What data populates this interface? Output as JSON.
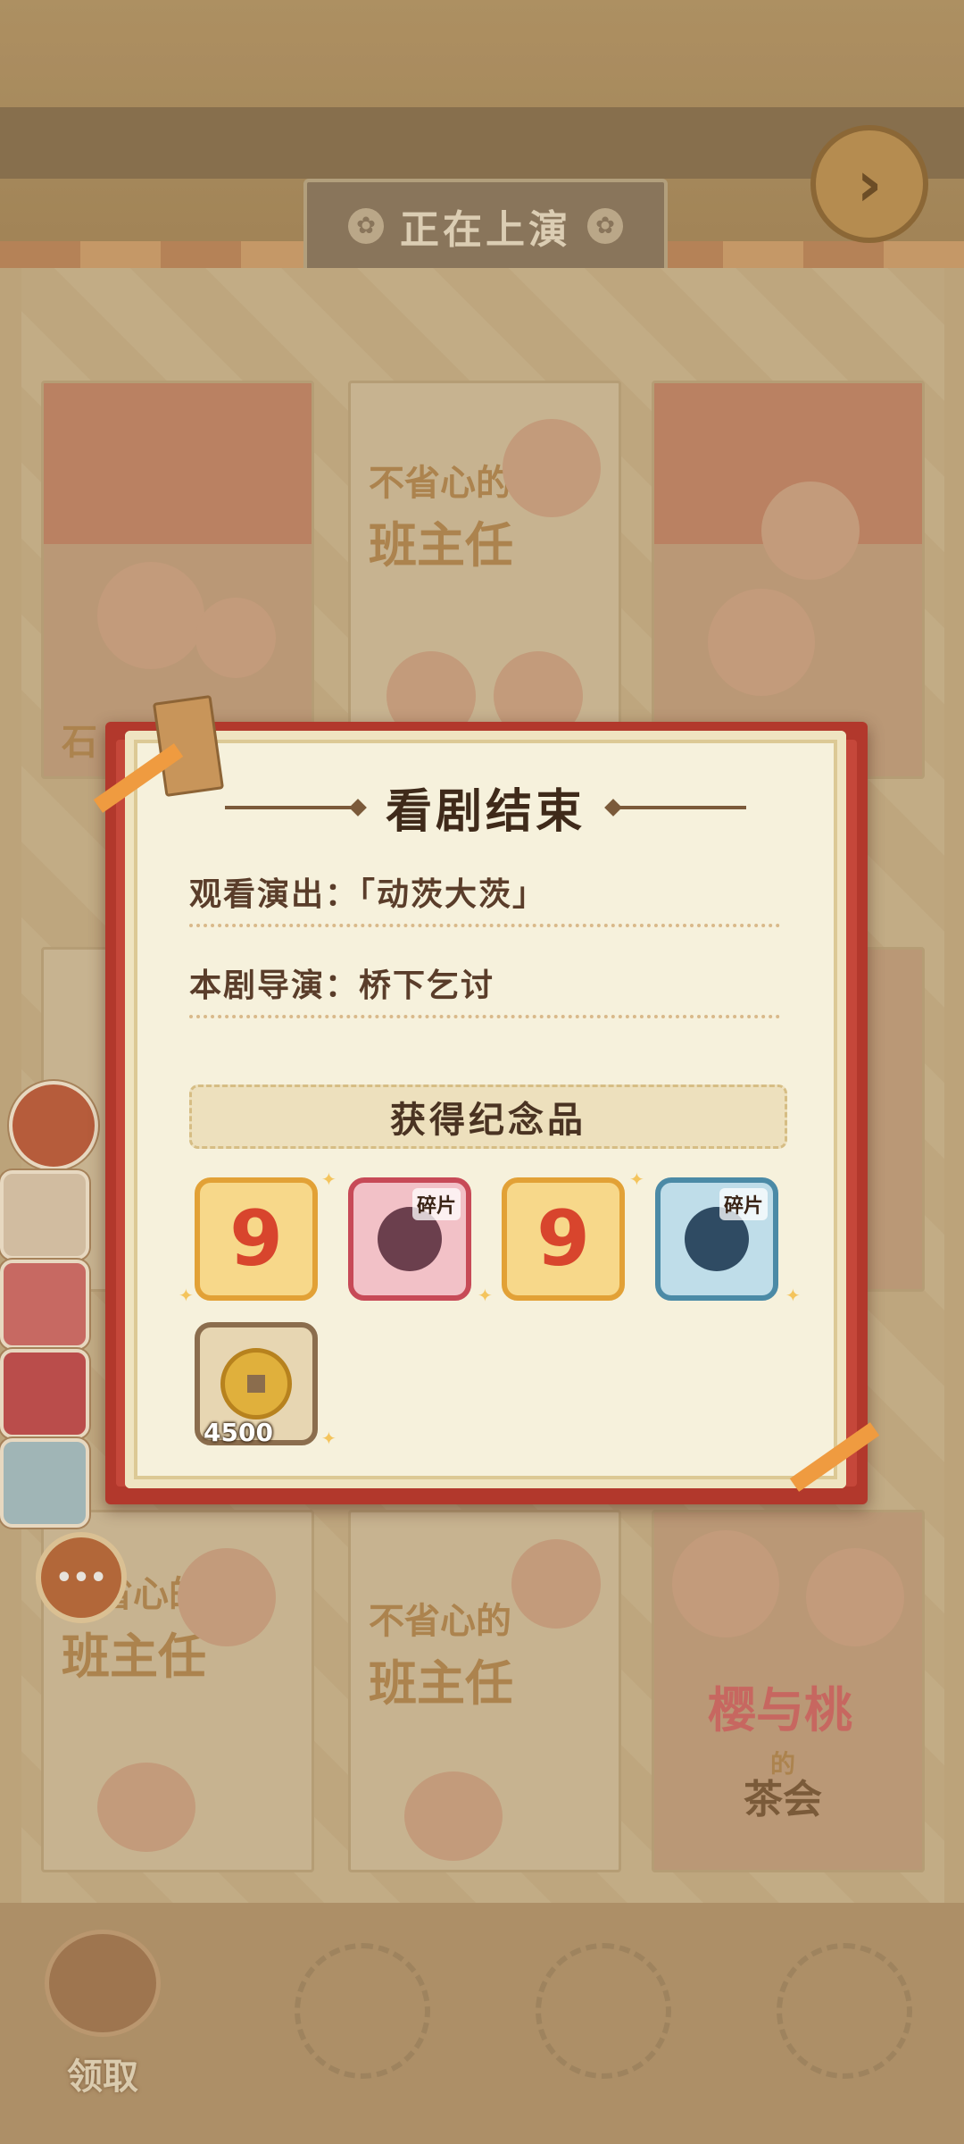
{
  "header": {
    "now_playing_label": "正在上演",
    "next_icon": "chevron-right-icon"
  },
  "posters": {
    "top_left_caption": "石",
    "top_middle_title_1": "不省心的",
    "top_middle_title_2": "班主任",
    "bottom_left_title_1": "不省心的",
    "bottom_left_title_2": "班主任",
    "bottom_middle_title_1": "不省心的",
    "bottom_middle_title_2": "班主任",
    "bottom_right_title": "樱与桃",
    "bottom_right_sub": "的",
    "bottom_right_sub2": "茶会"
  },
  "sidebar": {
    "more_icon": "more-icon"
  },
  "dialog": {
    "title": "看剧结束",
    "show_row": "观看演出：「动茨大茨」",
    "director_row": "本剧导演：桥下乞讨",
    "souvenir_label": "获得纪念品",
    "rewards": [
      {
        "kind": "ticket",
        "glyph": "9",
        "chip": ""
      },
      {
        "kind": "character-fragment",
        "glyph": "",
        "chip": "碎片"
      },
      {
        "kind": "ticket",
        "glyph": "9",
        "chip": ""
      },
      {
        "kind": "character-fragment",
        "glyph": "",
        "chip": "碎片"
      },
      {
        "kind": "coin",
        "glyph": "",
        "chip": "",
        "qty": "4500"
      }
    ]
  },
  "dock": {
    "claim_label": "领取"
  },
  "colors": {
    "dialog_frame": "#b2382c",
    "paper": "#f6f1dc",
    "text_dark": "#3f2a1a"
  }
}
